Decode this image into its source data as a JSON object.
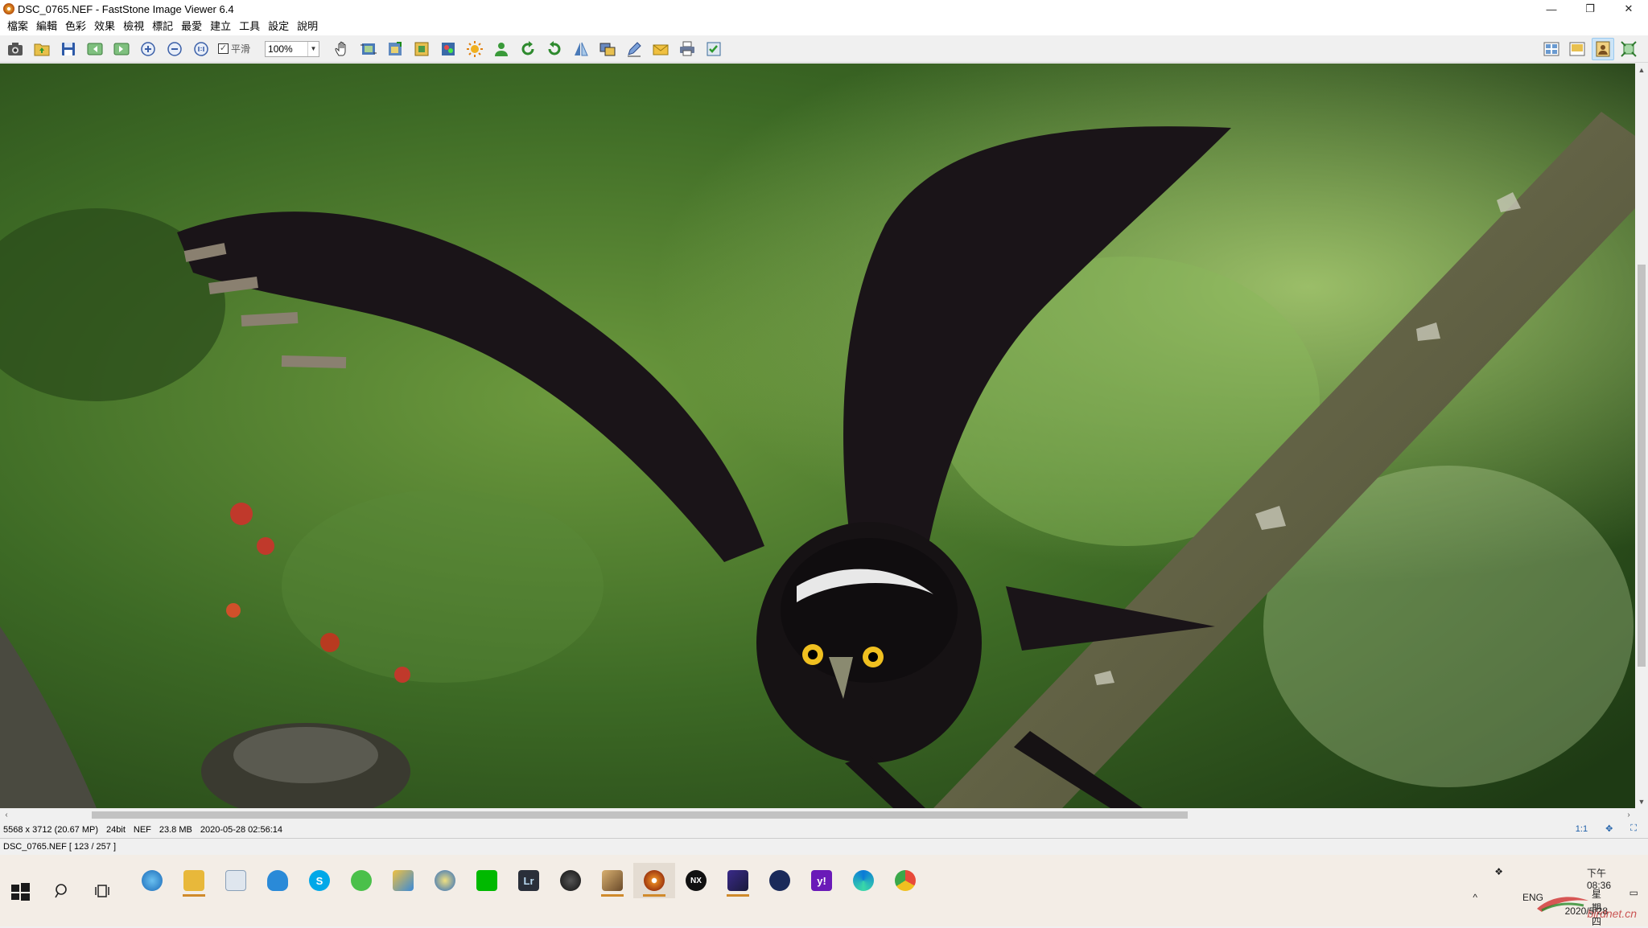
{
  "window": {
    "title": "DSC_0765.NEF  -  FastStone Image Viewer 6.4",
    "minimize": "—",
    "maximize": "❐",
    "close": "✕"
  },
  "menu": [
    "檔案",
    "編輯",
    "色彩",
    "效果",
    "檢視",
    "標記",
    "最愛",
    "建立",
    "工具",
    "設定",
    "說明"
  ],
  "toolbar": {
    "smooth_label": "平滑",
    "smooth_checked": "✓",
    "zoom_value": "100%",
    "zoom_dropdown": "▼"
  },
  "status": {
    "dimensions": "5568 x 3712 (20.67 MP)",
    "bitdepth": "24bit",
    "format": "NEF",
    "filesize": "23.8 MB",
    "datetime": "2020-05-28 02:56:14",
    "zoom_ratio": "1:1",
    "filename_position": "DSC_0765.NEF [ 123 / 257 ]"
  },
  "scroll": {
    "left_arrow": "‹",
    "right_arrow": "›",
    "up_arrow": "▲",
    "down_arrow": "▼"
  },
  "taskbar": {
    "tray_lang": "ENG",
    "tray_caret": "^",
    "clock_time": "下午 08:36",
    "clock_day": "星期四",
    "clock_date": "2020/5/28",
    "lr_label": "Lr",
    "yahoo_label": "y!",
    "nx_label": "NX",
    "s_label": "S"
  },
  "watermark": "birdnet.cn",
  "colors": {
    "accent": "#0078d7",
    "taskbar_bg": "#f3ede6",
    "running_indicator": "#d08a2b"
  }
}
